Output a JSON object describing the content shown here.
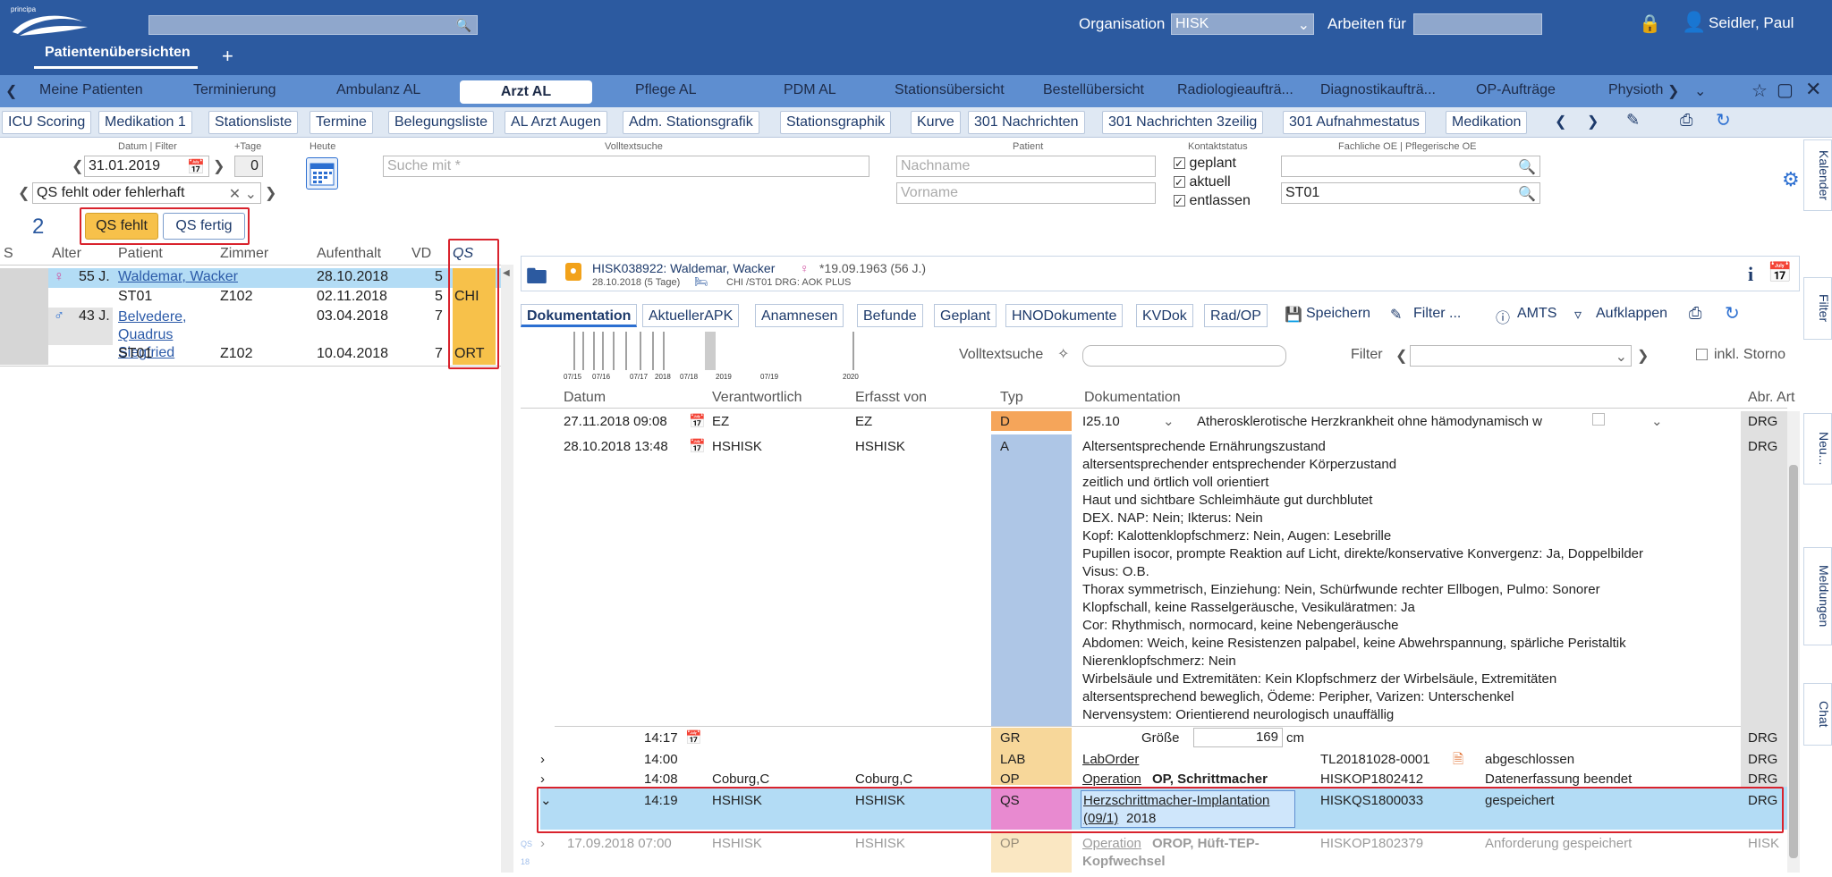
{
  "header": {
    "brand": "principa",
    "search_placeholder": "",
    "org_label": "Organisation",
    "org_value": "HISK",
    "work_label": "Arbeiten für",
    "work_value": "",
    "user_name": "Seidler, Paul",
    "add_tab": "+"
  },
  "main_tabs": [
    {
      "label": "Patientenübersichten"
    }
  ],
  "nav": {
    "items": [
      "Meine Patienten",
      "Terminierung",
      "Ambulanz AL",
      "Arzt AL",
      "Pflege AL",
      "PDM AL",
      "Stationsübersicht",
      "Bestellübersicht",
      "Radiologieaufträ...",
      "Diagnostikaufträ...",
      "OP-Aufträge",
      "Physioth"
    ],
    "active": "Arzt AL"
  },
  "subtabs": [
    "ICU Scoring",
    "Medikation 1",
    "Stationsliste",
    "Termine",
    "Belegungsliste",
    "AL Arzt Augen",
    "Adm. Stationsgrafik",
    "Stationsgraphik",
    "Kurve",
    "301 Nachrichten",
    "301 Nachrichten 3zeilig",
    "301 Aufnahmestatus",
    "Medikation"
  ],
  "filters": {
    "date_label": "Datum | Filter",
    "date": "31.01.2019",
    "plus_days_label": "+Tage",
    "plus_days": "0",
    "today_label": "Heute",
    "filter_value": "QS fehlt oder fehlerhaft",
    "fulltext_label": "Volltextsuche",
    "fulltext_placeholder": "Suche mit *",
    "patient_label": "Patient",
    "lastname_placeholder": "Nachname",
    "firstname_placeholder": "Vorname",
    "contact_label": "Kontaktstatus",
    "contact": [
      "geplant",
      "aktuell",
      "entlassen"
    ],
    "oe_label": "Fachliche OE | Pflegerische OE",
    "oe_value": "ST01"
  },
  "patient_list": {
    "count": "2",
    "btn_qs_missing": "QS fehlt",
    "btn_qs_done": "QS fertig",
    "headers": [
      "S",
      "Alter",
      "Patient",
      "Zimmer",
      "Aufenthalt",
      "VD",
      "QS"
    ],
    "rows": [
      {
        "sex": "♀",
        "age": "55 J.",
        "name": "Waldemar, Wacker",
        "room": "",
        "stay": "28.10.2018",
        "vd": "5",
        "qs": ""
      },
      {
        "sex": "",
        "age": "",
        "name": "ST01",
        "room": "Z102",
        "stay": "02.11.2018",
        "vd": "5",
        "qs": "CHI"
      },
      {
        "sex": "♂",
        "age": "43 J.",
        "name": "Belvedere, Quadrus Siegfried",
        "room": "",
        "stay": "03.04.2018",
        "vd": "7",
        "qs": ""
      },
      {
        "sex": "",
        "age": "",
        "name": "ST01",
        "room": "Z102",
        "stay": "10.04.2018",
        "vd": "7",
        "qs": "ORT"
      }
    ]
  },
  "patient_header": {
    "title": "HISK038922: Waldemar, Wacker",
    "sex": "♀",
    "dob": "*19.09.1963 (56 J.)",
    "sub": "28.10.2018 (5 Tage)",
    "sub2": "CHI /ST01 DRG: AOK PLUS"
  },
  "doc_tabs": [
    "Dokumentation",
    "AktuellerAPK",
    "Anamnesen",
    "Befunde",
    "Geplant",
    "HNODokumente",
    "KVDok",
    "Rad/OP"
  ],
  "doc_actions": {
    "save": "Speichern",
    "filter": "Filter ...",
    "amts": "AMTS",
    "expand": "Aufklappen"
  },
  "timeline": {
    "labels": [
      "07/15",
      "07/16",
      "07/17",
      "2018",
      "07/18",
      "2019",
      "07/19",
      "2020"
    ]
  },
  "doc_search": {
    "fulltext_label": "Volltextsuche",
    "filter_label": "Filter",
    "storno_label": "inkl. Storno"
  },
  "doc_table": {
    "headers": [
      "Datum",
      "Verantwortlich",
      "Erfasst von",
      "Typ",
      "Dokumentation",
      "Abr. Art"
    ],
    "rows": [
      {
        "date": "27.11.2018 09:08",
        "resp": "EZ",
        "by": "EZ",
        "type": "D",
        "code": "I25.10",
        "doc": "Atherosklerotische Herzkrankheit ohne hämodynamisch w",
        "abr": "DRG"
      },
      {
        "date": "28.10.2018 13:48",
        "resp": "HSHISK",
        "by": "HSHISK",
        "type": "A",
        "abr": "DRG",
        "lines": [
          "Altersentsprechende Ernährungszustand",
          "altersentsprechender entsprechender Körperzustand",
          "zeitlich und örtlich voll orientiert",
          "Haut und sichtbare Schleimhäute gut durchblutet",
          "DEX. NAP: Nein; Ikterus: Nein",
          "Kopf: Kalottenklopfschmerz: Nein, Augen: Lesebrille",
          "Pupillen isocor, prompte Reaktion auf Licht, direkte/konservative Konvergenz: Ja, Doppelbilder",
          "Visus: O.B.",
          "Thorax symmetrisch, Einziehung: Nein, Schürfwunde rechter Ellbogen, Pulmo: Sonorer",
          "Klopfschall, keine Rasselgeräusche, Vesikuläratmen: Ja",
          "Cor: Rhythmisch, normocard, keine Nebengeräusche",
          "Abdomen: Weich, keine Resistenzen palpabel, keine Abwehrspannung, spärliche Peristaltik",
          "Nierenklopfschmerz: Nein",
          "Wirbelsäule und Extremitäten: Kein Klopfschmerz der Wirbelsäule, Extremitäten",
          "altersentsprechend beweglich, Ödeme: Peripher, Varizen: Unterschenkel",
          "Nervensystem: Orientierend neurologisch unauffällig"
        ]
      },
      {
        "date": "14:17",
        "type": "GR",
        "label": "Größe",
        "value": "169",
        "unit": "cm",
        "abr": "DRG"
      },
      {
        "date": "14:00",
        "type": "LAB",
        "doc": "LabOrder",
        "id": "TL20181028-0001",
        "status": "abgeschlossen",
        "abr": "DRG"
      },
      {
        "date": "14:08",
        "resp": "Coburg,C",
        "by": "Coburg,C",
        "type": "OP",
        "doc_link": "Operation",
        "doc": "OP, Schrittmacher",
        "id": "HISKOP1802412",
        "status": "Datenerfassung beendet",
        "abr": "DRG"
      },
      {
        "date": "14:19",
        "resp": "HSHISK",
        "by": "HSHISK",
        "type": "QS",
        "doc": "Herzschrittmacher-Implantation",
        "doc2": "(09/1)",
        "year": "2018",
        "id": "HISKQS1800033",
        "status": "gespeichert",
        "abr": "DRG"
      },
      {
        "date": "17.09.2018 07:00",
        "resp": "HSHISK",
        "by": "HSHISK",
        "type": "OP",
        "doc_link": "Operation",
        "doc": "OROP, Hüft-TEP-",
        "doc2": "Kopfwechsel",
        "id": "HISKOP1802379",
        "status": "Anforderung gespeichert",
        "abr": "HISK"
      }
    ]
  },
  "side_tabs": [
    "Kalender",
    "Filter",
    "Neu...",
    "Meldungen",
    "Chat"
  ],
  "colors": {
    "header": "#2c5aa0",
    "nav": "#5e8ed0",
    "selected_row": "#b3dcf5",
    "qs_highlight": "#d9232d",
    "type_D": "#f5a55a",
    "type_A": "#aec6e6",
    "type_QS": "#e88ad0"
  }
}
